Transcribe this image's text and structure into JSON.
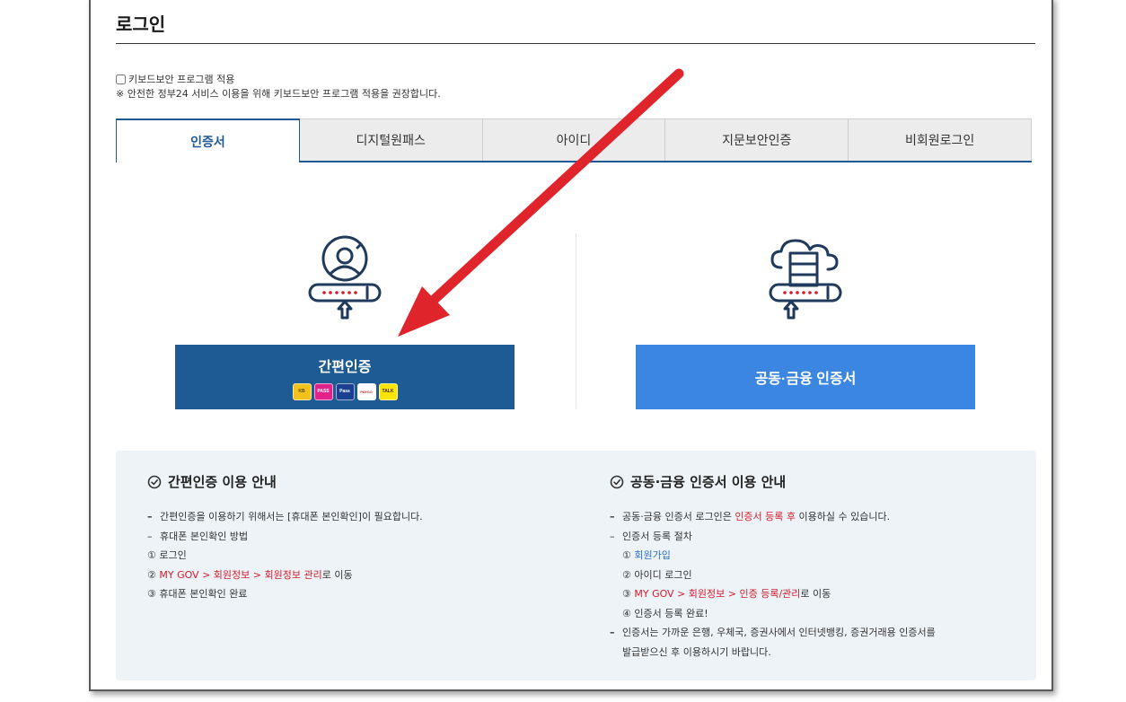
{
  "page": {
    "title": "로그인"
  },
  "keyboard_security": {
    "checkbox_label": "키보드보안 프로그램 적용",
    "checked": false,
    "note": "※ 안전한 정부24 서비스 이용을 위해 키보드보안 프로그램 적용을 권장합니다."
  },
  "tabs": [
    {
      "label": "인증서",
      "active": true
    },
    {
      "label": "디지털원패스",
      "active": false
    },
    {
      "label": "아이디",
      "active": false
    },
    {
      "label": "지문보안인증",
      "active": false
    },
    {
      "label": "비회원로그인",
      "active": false
    }
  ],
  "options": {
    "easy": {
      "icon": "user-password-icon",
      "button_label": "간편인증",
      "providers": [
        {
          "name": "kb-icon",
          "text": "KB",
          "bg": "#f2c21a",
          "fg": "#5a4a00"
        },
        {
          "name": "pass-icon",
          "text": "PASS",
          "bg": "#e0228a",
          "fg": "#ffffff"
        },
        {
          "name": "samsung-pass-icon",
          "text": "Pass",
          "bg": "#1b3f92",
          "fg": "#ffffff"
        },
        {
          "name": "payco-icon",
          "text": "PAYCO",
          "bg": "#ffffff",
          "fg": "#e02020"
        },
        {
          "name": "kakao-icon",
          "text": "TALK",
          "bg": "#fde500",
          "fg": "#3a1d1d"
        }
      ]
    },
    "cert": {
      "icon": "cloud-server-password-icon",
      "button_label": "공동·금융 인증서"
    }
  },
  "guide": {
    "easy": {
      "heading": "간편인증 이용 안내",
      "lines": [
        {
          "type": "dash",
          "parts": [
            {
              "text": "간편인증을 이용하기 위해서는 [휴대폰 본인확인]이 필요합니다."
            }
          ]
        },
        {
          "type": "tilde",
          "parts": [
            {
              "text": "휴대폰 본인확인 방법"
            }
          ]
        },
        {
          "type": "plain",
          "parts": [
            {
              "text": "① 로그인"
            }
          ]
        },
        {
          "type": "plain",
          "parts": [
            {
              "text": "② "
            },
            {
              "text": "MY GOV > 회원정보 > 회원정보 관리",
              "color": "red"
            },
            {
              "text": "로 이동"
            }
          ]
        },
        {
          "type": "plain",
          "parts": [
            {
              "text": "③ 휴대폰 본인확인 완료"
            }
          ]
        }
      ]
    },
    "cert": {
      "heading": "공동·금융 인증서 이용 안내",
      "lines": [
        {
          "type": "dash",
          "parts": [
            {
              "text": "공동·금융 인증서 로그인은 "
            },
            {
              "text": "인증서 등록 후",
              "color": "red"
            },
            {
              "text": " 이용하실 수 있습니다."
            }
          ]
        },
        {
          "type": "tilde",
          "parts": [
            {
              "text": "인증서 등록 절차"
            }
          ]
        },
        {
          "type": "sub",
          "parts": [
            {
              "text": "① "
            },
            {
              "text": "회원가입",
              "color": "blue"
            }
          ]
        },
        {
          "type": "sub",
          "parts": [
            {
              "text": "② 아이디 로그인"
            }
          ]
        },
        {
          "type": "sub",
          "parts": [
            {
              "text": "③ "
            },
            {
              "text": "MY GOV > 회원정보 > 인증 등록/관리",
              "color": "red"
            },
            {
              "text": "로 이동"
            }
          ]
        },
        {
          "type": "sub",
          "parts": [
            {
              "text": "④ 인증서 등록 완료!"
            }
          ]
        },
        {
          "type": "dash",
          "parts": [
            {
              "text": "인증서는 가까운 은행, 우체국, 증권사에서 인터넷뱅킹, 증권거래용 인증서를"
            }
          ]
        },
        {
          "type": "cont",
          "parts": [
            {
              "text": "발급받으신 후 이용하시기 바랍니다."
            }
          ]
        }
      ]
    }
  },
  "colors": {
    "easy_button": "#1e5a93",
    "cert_button": "#3a86e0",
    "icon_navy": "#1f3a5c",
    "arrow": "#e0242b"
  }
}
